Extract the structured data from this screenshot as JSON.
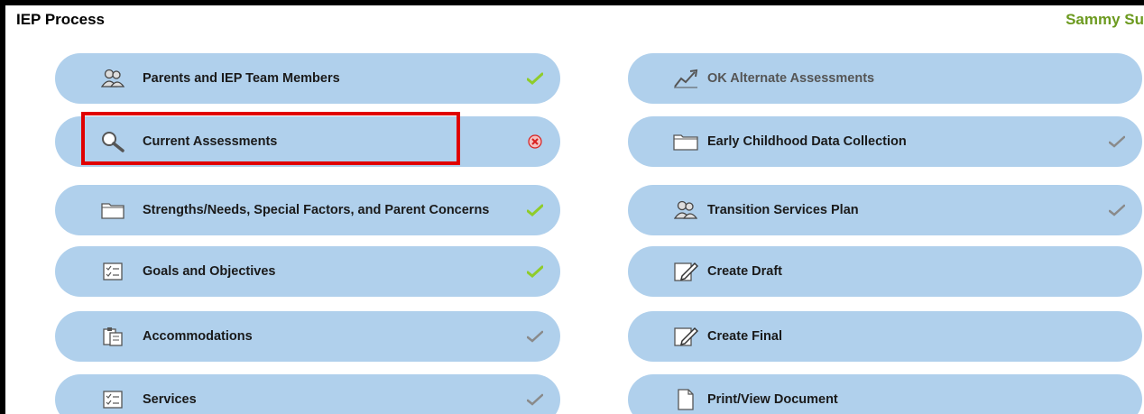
{
  "header": {
    "title": "IEP Process",
    "user": "Sammy Su"
  },
  "left_items": [
    {
      "label": "Parents and IEP Team Members",
      "icon": "people-icon",
      "status": "complete"
    },
    {
      "label": "Current Assessments",
      "icon": "magnifier-icon",
      "status": "error"
    },
    {
      "label": "Strengths/Needs, Special Factors, and Parent Concerns",
      "icon": "folder-icon",
      "status": "complete"
    },
    {
      "label": "Goals and Objectives",
      "icon": "checklist-icon",
      "status": "complete"
    },
    {
      "label": "Accommodations",
      "icon": "clipboard-icon",
      "status": "pending"
    },
    {
      "label": "Services",
      "icon": "checklist-icon",
      "status": "pending"
    }
  ],
  "right_items": [
    {
      "label": "OK Alternate Assessments",
      "icon": "chart-arrow-icon",
      "status": "none"
    },
    {
      "label": "Early Childhood Data Collection",
      "icon": "folder-icon",
      "status": "pending"
    },
    {
      "label": "Transition Services Plan",
      "icon": "people-icon",
      "status": "pending"
    },
    {
      "label": "Create Draft",
      "icon": "edit-document-icon",
      "status": "none"
    },
    {
      "label": "Create Final",
      "icon": "edit-document-icon",
      "status": "none"
    },
    {
      "label": "Print/View Document",
      "icon": "document-icon",
      "status": "none"
    }
  ],
  "colors": {
    "pill": "#b0d0ec",
    "title_user": "#6c9a1f",
    "check_green": "#8fcc2a",
    "check_gray": "#8a8a8a",
    "error_red": "#d92020",
    "highlight": "#e00000"
  }
}
